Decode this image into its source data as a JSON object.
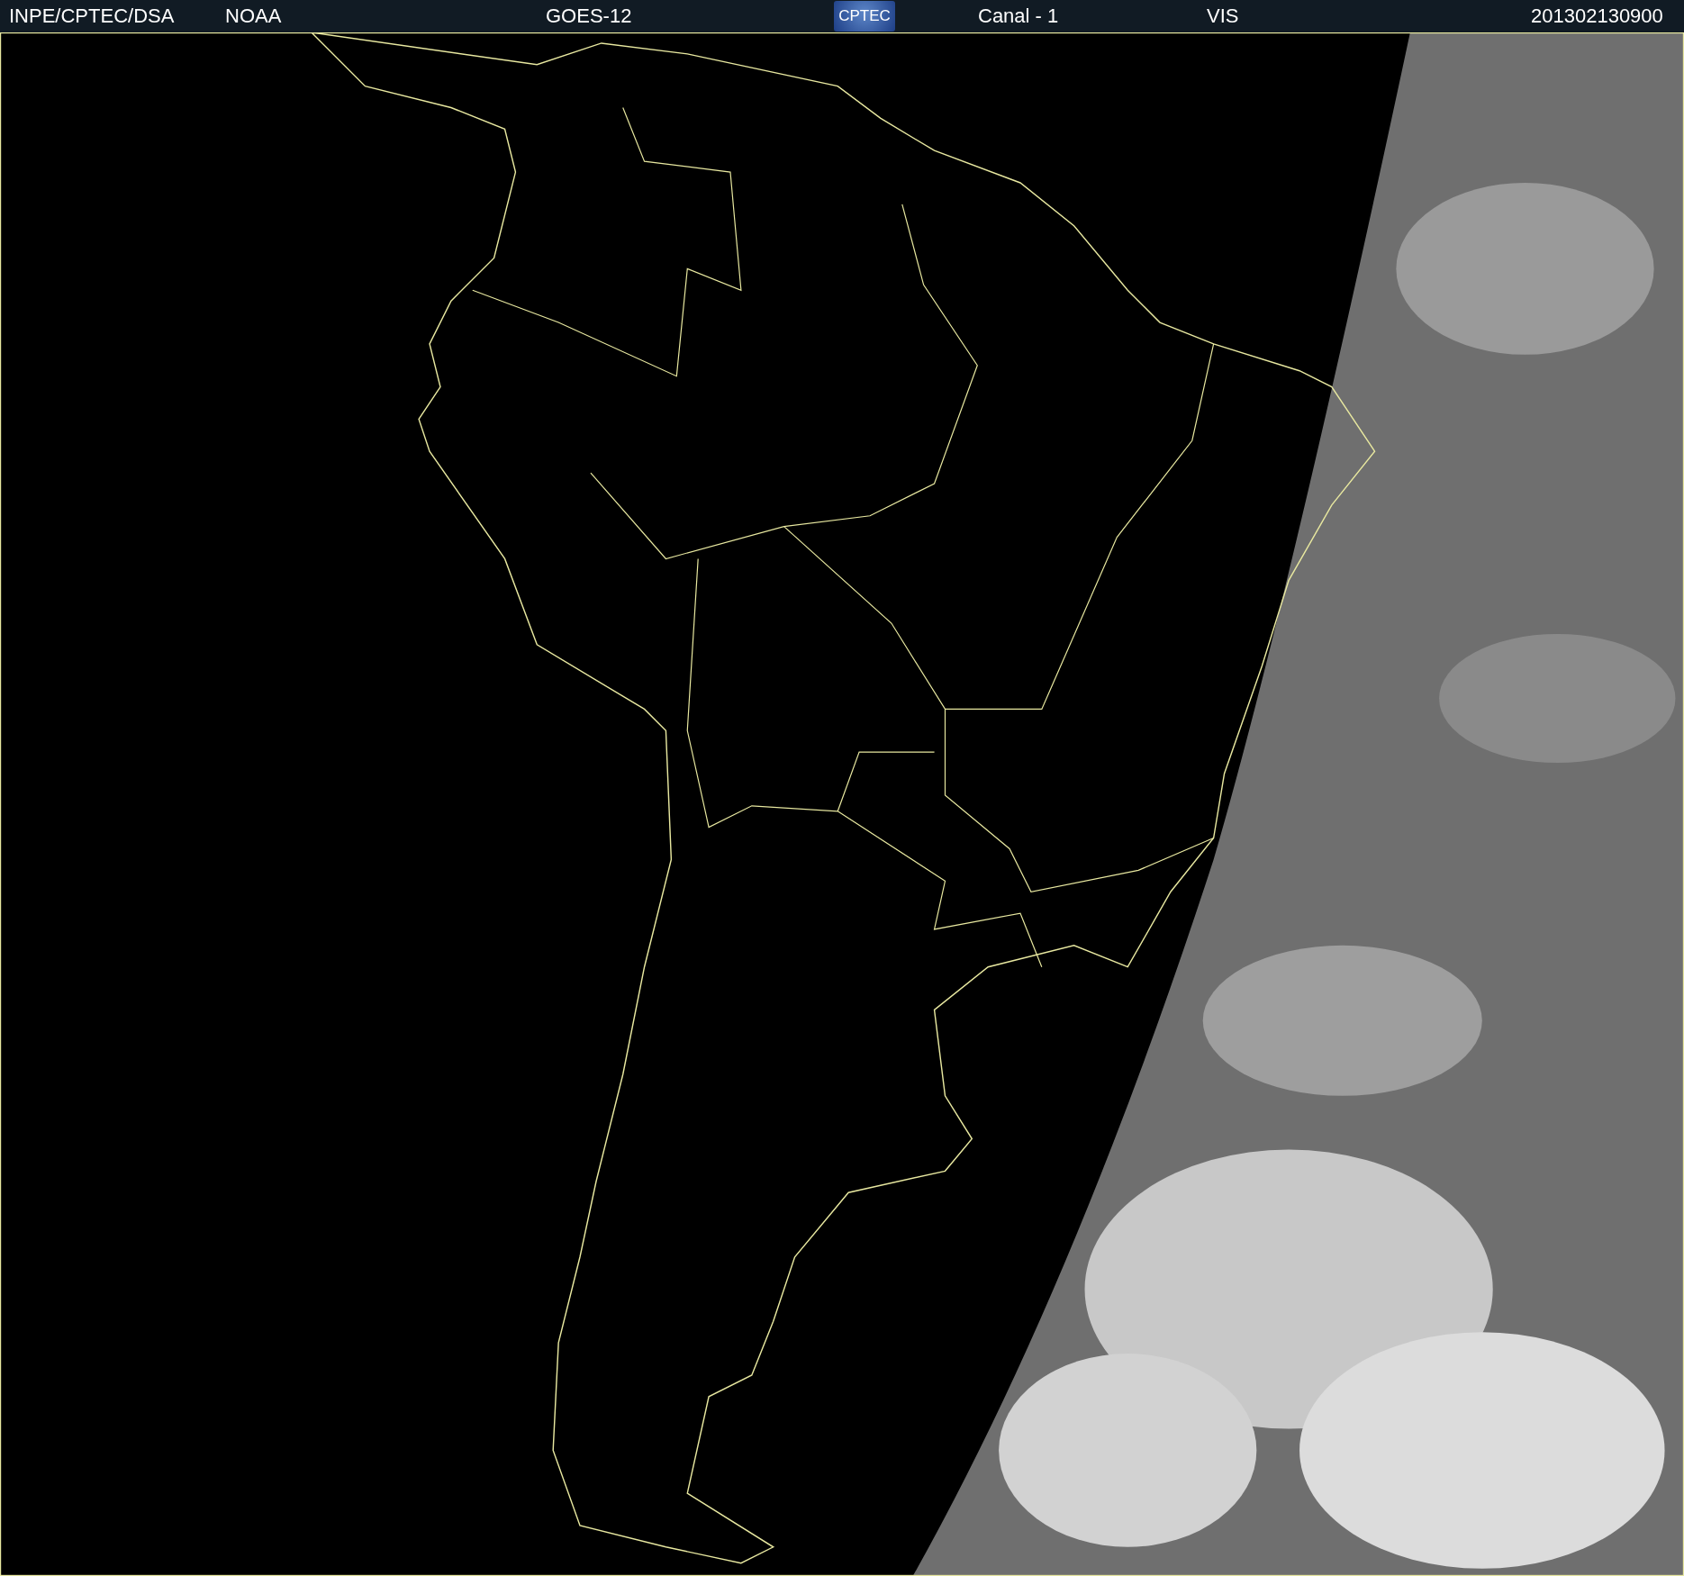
{
  "header": {
    "items": [
      {
        "kind": "text",
        "text": "INPE/CPTEC/DSA"
      },
      {
        "kind": "text",
        "text": "NOAA"
      },
      {
        "kind": "text",
        "text": "GOES-12"
      },
      {
        "kind": "logo",
        "text": "CPTEC"
      },
      {
        "kind": "text",
        "text": "Canal - 1"
      },
      {
        "kind": "text",
        "text": "VIS"
      },
      {
        "kind": "text",
        "text": "201302130900"
      }
    ]
  }
}
